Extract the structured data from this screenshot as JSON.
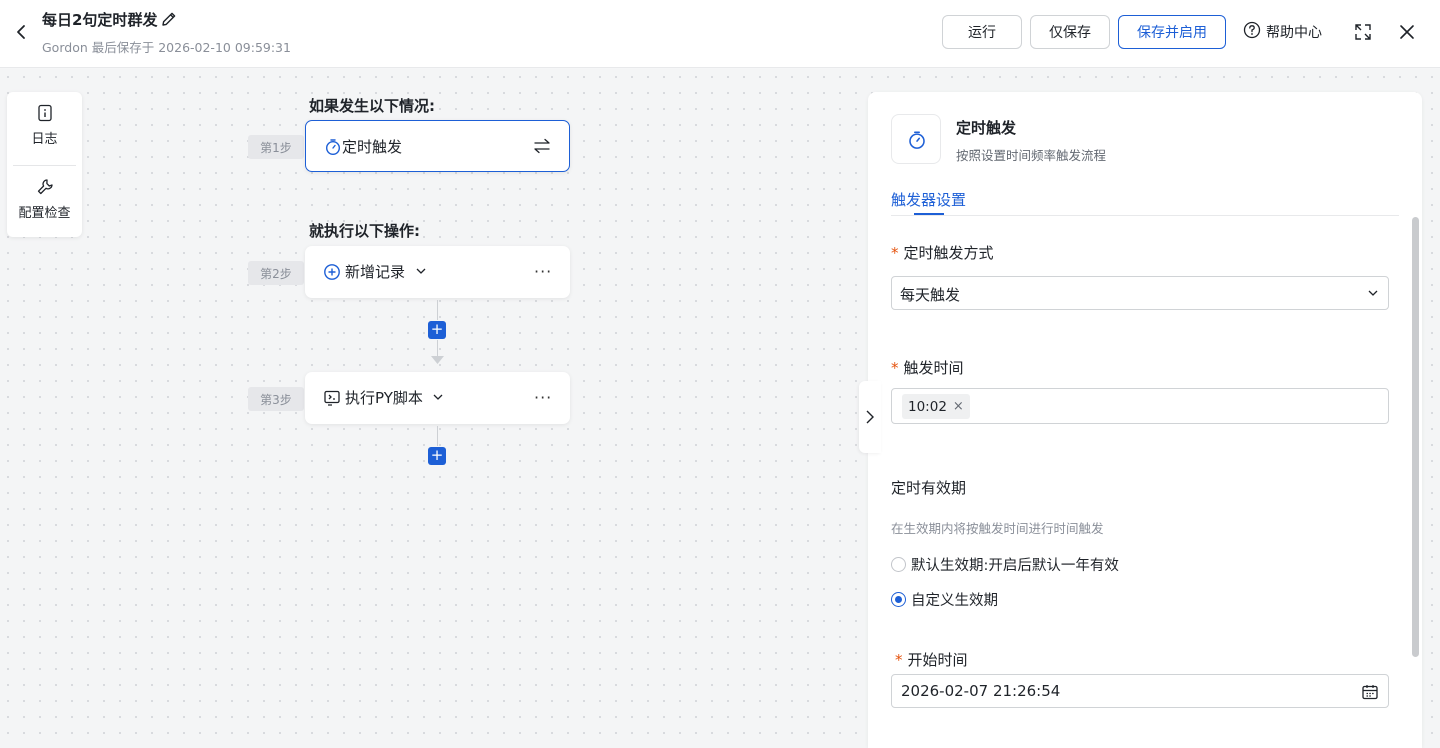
{
  "header": {
    "title": "每日2句定时群发",
    "save_meta": "Gordon 最后保存于 2026-02-10 09:59:31",
    "run_label": "运行",
    "save_only_label": "仅保存",
    "save_enable_label": "保存并启用",
    "help_label": "帮助中心"
  },
  "tools": {
    "log_label": "日志",
    "check_label": "配置检查"
  },
  "flow": {
    "if_title": "如果发生以下情况:",
    "then_title": "就执行以下操作:",
    "steps": [
      {
        "tag": "第1步",
        "label": "定时触发",
        "icon": "timer-icon"
      },
      {
        "tag": "第2步",
        "label": "新增记录",
        "icon": "plus-circle-icon"
      },
      {
        "tag": "第3步",
        "label": "执行PY脚本",
        "icon": "script-icon"
      }
    ],
    "more_glyph": "···",
    "add_glyph": "+"
  },
  "panel": {
    "title": "定时触发",
    "description": "按照设置时间频率触发流程",
    "tab": "触发器设置",
    "required_mark": "*",
    "mode_label": "定时触发方式",
    "mode_value": "每天触发",
    "time_label": "触发时间",
    "time_chip": "10:02",
    "chip_close": "×",
    "validity_label": "定时有效期",
    "validity_hint": "在生效期内将按触发时间进行时间触发",
    "radio_default": "默认生效期:开启后默认一年有效",
    "radio_custom": "自定义生效期",
    "radio_selected": "自定义生效期",
    "start_label": "开始时间",
    "start_value": "2026-02-07 21:26:54"
  },
  "colors": {
    "accent": "#1d5fd6",
    "required": "#e5540f"
  }
}
